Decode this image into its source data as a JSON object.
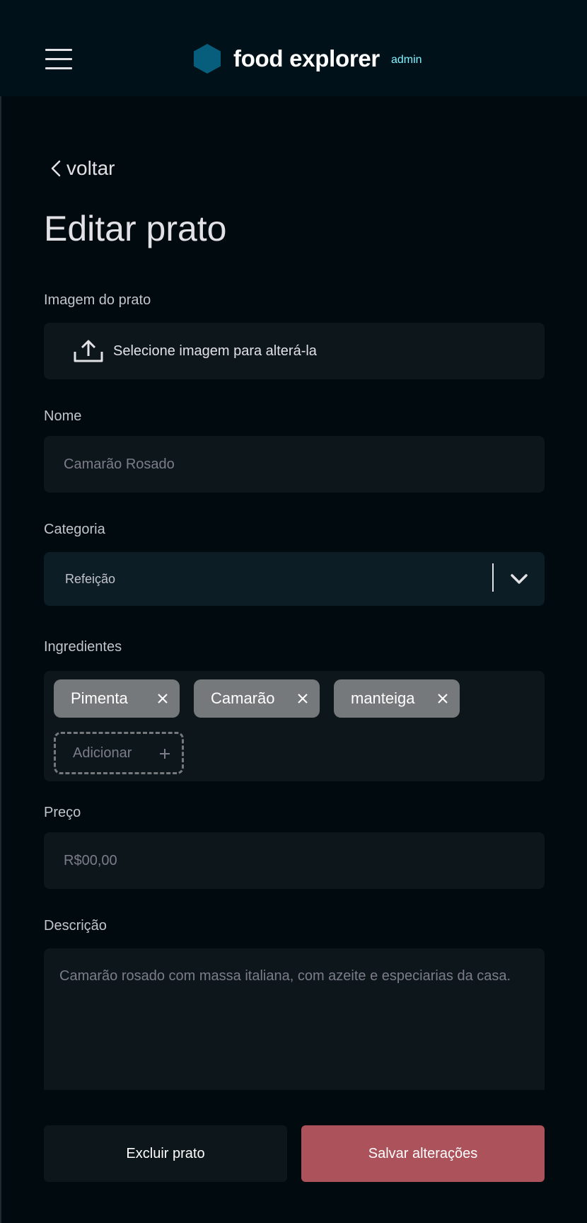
{
  "header": {
    "brand": "food explorer",
    "badge": "admin",
    "colors": {
      "background": "#00111a",
      "logo": "#065e7c",
      "badge": "#82f3ff"
    },
    "icons": {
      "menu": "menu-icon",
      "logo": "hexagon-logo-icon"
    }
  },
  "nav": {
    "back_label": "voltar"
  },
  "page": {
    "title": "Editar prato"
  },
  "form": {
    "image": {
      "label": "Imagem do prato",
      "button_text": "Selecione imagem para alterá-la"
    },
    "name": {
      "label": "Nome",
      "placeholder": "Camarão Rosado"
    },
    "category": {
      "label": "Categoria",
      "value": "Refeição"
    },
    "ingredients": {
      "label": "Ingredientes",
      "items": [
        {
          "label": "Pimenta"
        },
        {
          "label": "Camarão"
        },
        {
          "label": "manteiga"
        }
      ],
      "add_placeholder": "Adicionar"
    },
    "price": {
      "label": "Preço",
      "placeholder": "R$00,00"
    },
    "description": {
      "label": "Descrição",
      "placeholder": "Camarão rosado com massa italiana, com azeite e especiarias da casa."
    }
  },
  "actions": {
    "delete_label": "Excluir prato",
    "save_label": "Salvar alterações",
    "colors": {
      "save": "#ab525a",
      "delete": "#0d161b"
    }
  }
}
